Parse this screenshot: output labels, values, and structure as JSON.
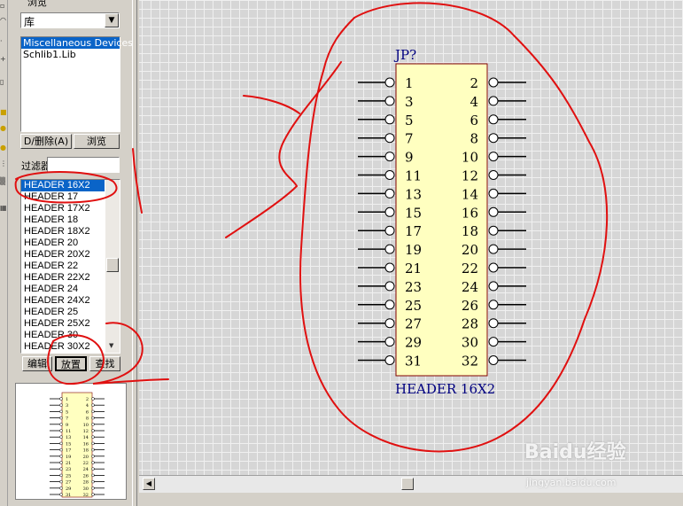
{
  "browser": {
    "title": "浏览",
    "mode_select": "库",
    "libraries": [
      "Miscellaneous Devices",
      "Schlib1.Lib"
    ],
    "selected_library_index": 0,
    "add_remove_button": "D/删除(A)",
    "browse_button": "浏览",
    "filter_label": "过滤器",
    "filter_value": "",
    "parts": [
      "HEADER 16X2",
      "HEADER 17",
      "HEADER 17X2",
      "HEADER 18",
      "HEADER 18X2",
      "HEADER 20",
      "HEADER 20X2",
      "HEADER 22",
      "HEADER 22X2",
      "HEADER 24",
      "HEADER 24X2",
      "HEADER 25",
      "HEADER 25X2",
      "HEADER 30",
      "HEADER 30X2"
    ],
    "selected_part_index": 0,
    "edit_button": "编辑",
    "place_button": "放置",
    "find_button": "查找"
  },
  "component": {
    "designator": "JP?",
    "name": "HEADER 16X2",
    "left_pins": [
      "1",
      "3",
      "5",
      "7",
      "9",
      "11",
      "13",
      "15",
      "17",
      "19",
      "21",
      "23",
      "25",
      "27",
      "29",
      "31"
    ],
    "right_pins": [
      "2",
      "4",
      "6",
      "8",
      "10",
      "12",
      "14",
      "16",
      "18",
      "20",
      "22",
      "24",
      "26",
      "28",
      "30",
      "32"
    ],
    "body_color": "#ffffc0",
    "label_color": "#000080"
  },
  "watermark": {
    "brand": "Baidu经验",
    "url": "jingyan.baidu.com"
  },
  "colors": {
    "annotation": "#e01010",
    "selection": "#0a64c8"
  }
}
